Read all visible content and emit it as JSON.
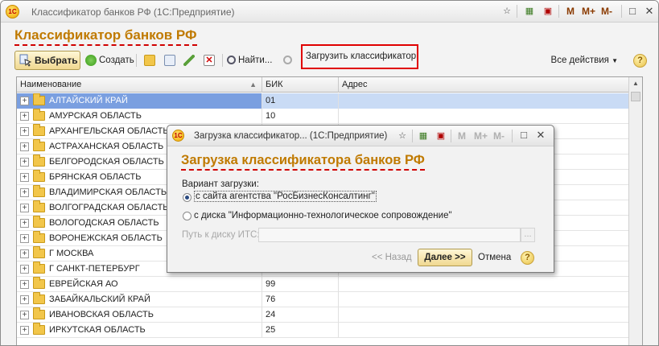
{
  "window": {
    "title": "Классификатор банков РФ  (1С:Предприятие)",
    "form_title": "Классификатор банков РФ",
    "m_buttons": [
      "M",
      "M+",
      "M-"
    ]
  },
  "toolbar": {
    "select_label": "Выбрать",
    "create_label": "Создать",
    "find_label": "Найти...",
    "load_classifier_label": "Загрузить классификатор",
    "all_actions_label": "Все действия",
    "help_label": "?"
  },
  "table": {
    "columns": [
      "Наименование",
      "БИК",
      "Адрес"
    ],
    "rows": [
      {
        "name": "АЛТАЙСКИЙ КРАЙ",
        "bik": "01",
        "address": "",
        "selected": true
      },
      {
        "name": "АМУРСКАЯ ОБЛАСТЬ",
        "bik": "10",
        "address": ""
      },
      {
        "name": "АРХАНГЕЛЬСКАЯ ОБЛАСТЬ",
        "bik": "",
        "address": ""
      },
      {
        "name": "АСТРАХАНСКАЯ ОБЛАСТЬ",
        "bik": "",
        "address": ""
      },
      {
        "name": "БЕЛГОРОДСКАЯ ОБЛАСТЬ",
        "bik": "",
        "address": ""
      },
      {
        "name": "БРЯНСКАЯ ОБЛАСТЬ",
        "bik": "",
        "address": ""
      },
      {
        "name": "ВЛАДИМИРСКАЯ ОБЛАСТЬ",
        "bik": "",
        "address": ""
      },
      {
        "name": "ВОЛГОГРАДСКАЯ ОБЛАСТЬ",
        "bik": "",
        "address": ""
      },
      {
        "name": "ВОЛОГОДСКАЯ ОБЛАСТЬ",
        "bik": "",
        "address": ""
      },
      {
        "name": "ВОРОНЕЖСКАЯ ОБЛАСТЬ",
        "bik": "",
        "address": ""
      },
      {
        "name": "Г МОСКВА",
        "bik": "",
        "address": ""
      },
      {
        "name": "Г САНКТ-ПЕТЕРБУРГ",
        "bik": "",
        "address": ""
      },
      {
        "name": "ЕВРЕЙСКАЯ АО",
        "bik": "99",
        "address": ""
      },
      {
        "name": "ЗАБАЙКАЛЬСКИЙ КРАЙ",
        "bik": "76",
        "address": ""
      },
      {
        "name": "ИВАНОВСКАЯ ОБЛАСТЬ",
        "bik": "24",
        "address": ""
      },
      {
        "name": "ИРКУТСКАЯ ОБЛАСТЬ",
        "bik": "25",
        "address": ""
      }
    ]
  },
  "dialog": {
    "title": "Загрузка классификатор...  (1С:Предприятие)",
    "heading": "Загрузка классификатора банков РФ",
    "variant_label": "Вариант загрузки:",
    "option_site": "с сайта агентства \"РосБизнесКонсалтинг\"",
    "option_disk": "с диска \"Информационно-технологическое сопровождение\"",
    "selected_option": "site",
    "path_label": "Путь к диску ИТС:",
    "path_value": "",
    "browse_label": "...",
    "back_label": "<< Назад",
    "next_label": "Далее >>",
    "cancel_label": "Отмена",
    "help_label": "?",
    "m_buttons": [
      "M",
      "M+",
      "M-"
    ]
  },
  "colors": {
    "title_accent": "#c07a00",
    "dashed_underline": "#d00000",
    "highlight_box": "#e00000",
    "selection": "#7a9fe0"
  }
}
